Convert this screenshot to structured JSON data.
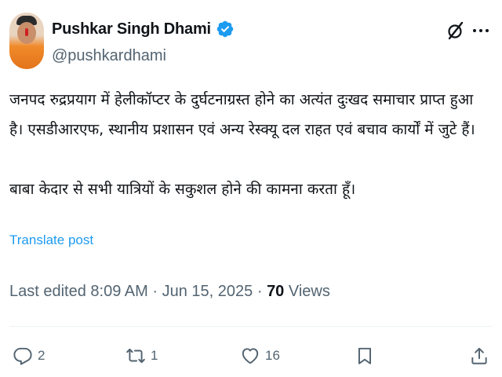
{
  "author": {
    "display_name": "Pushkar Singh Dhami",
    "handle": "@pushkardhami",
    "verified": true
  },
  "post": {
    "lines": [
      "जनपद रुद्रप्रयाग में हेलीकॉप्टर के दुर्घटनाग्रस्त होने का अत्यंत दुःखद समाचार प्राप्त हुआ",
      "है। एसडीआरएफ, स्थानीय प्रशासन एवं अन्य रेस्क्यू दल राहत एवं बचाव कार्यों में जुटे हैं।",
      "बाबा केदार से सभी यात्रियों के सकुशल होने की कामना करता हूँ।"
    ],
    "translate_label": "Translate post",
    "edited_label": "Last edited",
    "time": "8:09 AM",
    "separator": "·",
    "date": "Jun 15, 2025",
    "views_count": "70",
    "views_label": "Views"
  },
  "actions": {
    "replies": "2",
    "reposts": "1",
    "likes": "16"
  },
  "colors": {
    "accent": "#1d9bf0",
    "text": "#0f1419",
    "muted": "#536471"
  },
  "icons": [
    "verified-badge-icon",
    "grok-icon",
    "more-icon",
    "reply-icon",
    "repost-icon",
    "like-icon",
    "bookmark-icon",
    "share-icon"
  ]
}
